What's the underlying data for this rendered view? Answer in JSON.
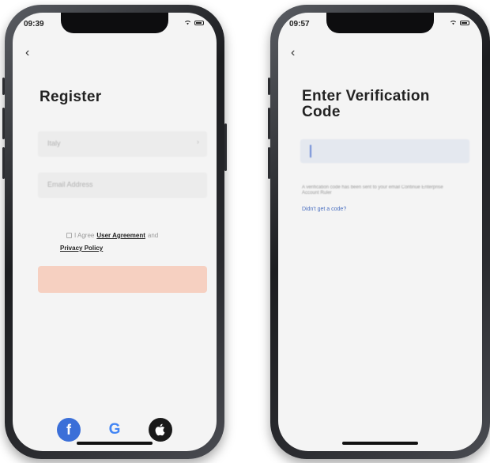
{
  "left_phone": {
    "status_time": "09:39",
    "title": "Register",
    "country_value": "Italy",
    "email_placeholder": "Email Address",
    "agree_prefix": "I Agree",
    "user_agreement": "User Agreement",
    "and_text": "and",
    "privacy_policy": "Privacy Policy",
    "social": [
      {
        "name": "facebook-icon",
        "glyph": "f"
      },
      {
        "name": "google-icon",
        "glyph": "G"
      },
      {
        "name": "apple-icon",
        "glyph": ""
      }
    ]
  },
  "right_phone": {
    "status_time": "09:57",
    "title_line1": "Enter Verification",
    "title_line2": "Code",
    "description": "A verification code has been sent to your email Continue Enterprise Account Ruler",
    "resend_link": "Didn't get a code?"
  },
  "colors": {
    "submit_disabled": "#f6d0c1",
    "link_blue": "#4a6fc0",
    "facebook": "#3b6fd8"
  }
}
